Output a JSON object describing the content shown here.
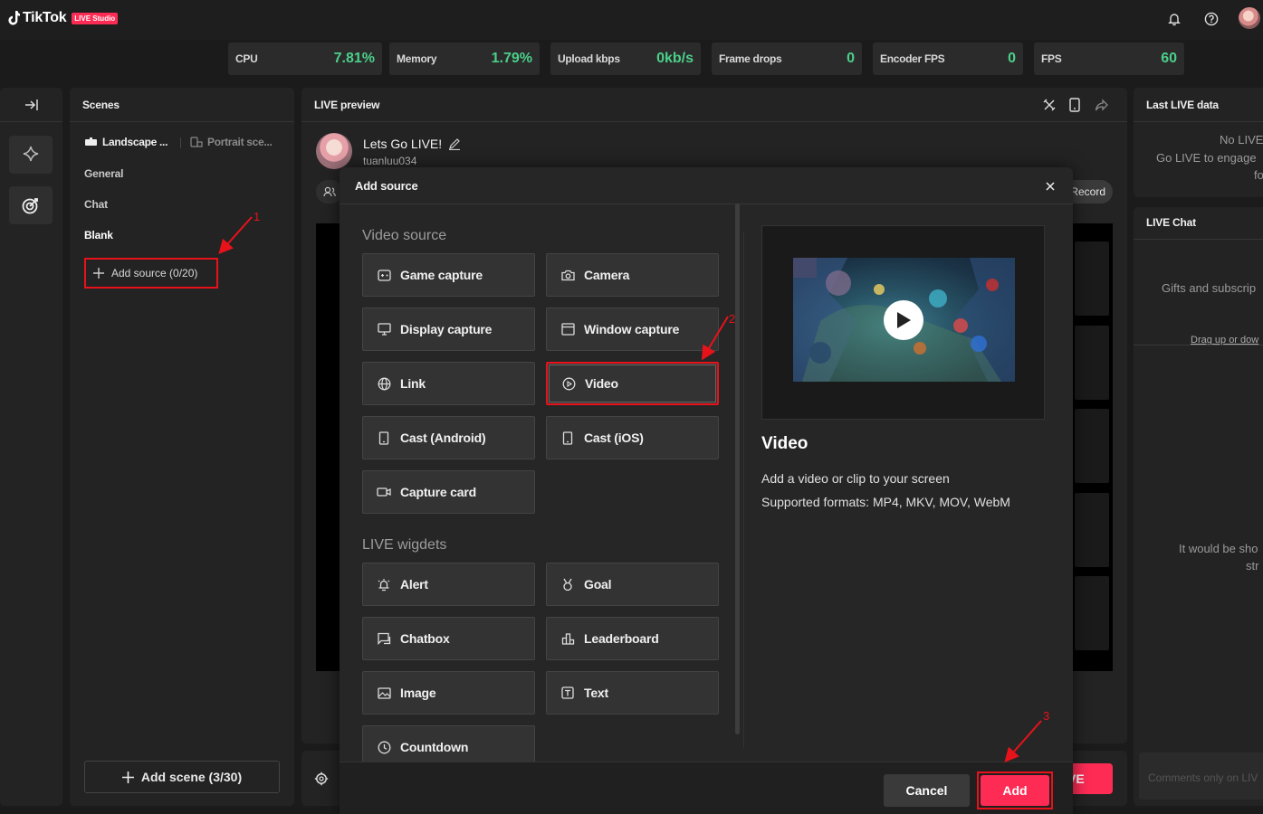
{
  "app": {
    "brand": "TikTok",
    "badge": "LIVE Studio"
  },
  "stats": [
    {
      "label": "CPU",
      "value": "7.81%"
    },
    {
      "label": "Memory",
      "value": "1.79%"
    },
    {
      "label": "Upload kbps",
      "value": "0kb/s"
    },
    {
      "label": "Frame drops",
      "value": "0"
    },
    {
      "label": "Encoder FPS",
      "value": "0"
    },
    {
      "label": "FPS",
      "value": "60"
    }
  ],
  "scenes": {
    "title": "Scenes",
    "tabs": [
      "Landscape ...",
      "Portrait sce..."
    ],
    "items": [
      "General",
      "Chat",
      "Blank"
    ],
    "add_source": "Add source (0/20)",
    "add_scene": "Add scene (3/30)"
  },
  "preview": {
    "title": "LIVE preview",
    "stream_title": "Lets Go LIVE!",
    "username": "tuanluu034",
    "record_label": "Record",
    "go_live_partial": "VE"
  },
  "right": {
    "last_live_title": "Last LIVE data",
    "no_live_l1": "No LIVE",
    "no_live_l2": "Go LIVE to engage",
    "no_live_l3": "fol",
    "live_chat_title": "LIVE Chat",
    "gifts_text": "Gifts and subscrip",
    "drag_text": "Drag up or dow",
    "would_l1": "It would be sho",
    "would_l2": "str",
    "comments_placeholder": "Comments only on LIV"
  },
  "modal": {
    "title": "Add source",
    "video_section": "Video source",
    "widgets_section": "LIVE wigdets",
    "video_sources": [
      {
        "label": "Game capture",
        "icon": "gamepad-icon"
      },
      {
        "label": "Camera",
        "icon": "camera-icon"
      },
      {
        "label": "Display capture",
        "icon": "monitor-icon"
      },
      {
        "label": "Window capture",
        "icon": "window-icon"
      },
      {
        "label": "Link",
        "icon": "globe-icon"
      },
      {
        "label": "Video",
        "icon": "play-circle-icon"
      },
      {
        "label": "Cast (Android)",
        "icon": "phone-icon"
      },
      {
        "label": "Cast (iOS)",
        "icon": "phone-icon"
      },
      {
        "label": "Capture card",
        "icon": "video-camera-icon"
      }
    ],
    "widgets": [
      {
        "label": "Alert",
        "icon": "alert-icon"
      },
      {
        "label": "Goal",
        "icon": "medal-icon"
      },
      {
        "label": "Chatbox",
        "icon": "chatbox-icon"
      },
      {
        "label": "Leaderboard",
        "icon": "leaderboard-icon"
      },
      {
        "label": "Image",
        "icon": "image-icon"
      },
      {
        "label": "Text",
        "icon": "text-icon"
      },
      {
        "label": "Countdown",
        "icon": "clock-icon"
      }
    ],
    "selected": "Video",
    "desc_title": "Video",
    "desc_line1": "Add a video or clip to your screen",
    "desc_line2": "Supported formats: MP4, MKV, MOV, WebM",
    "cancel": "Cancel",
    "add": "Add"
  },
  "annotations": [
    "1",
    "2",
    "3"
  ],
  "colors": {
    "accent": "#fe2c55",
    "annotation_red": "#e8121b",
    "stat_green": "#4bd08a",
    "panel": "#232323",
    "background": "#1b1b1b"
  }
}
